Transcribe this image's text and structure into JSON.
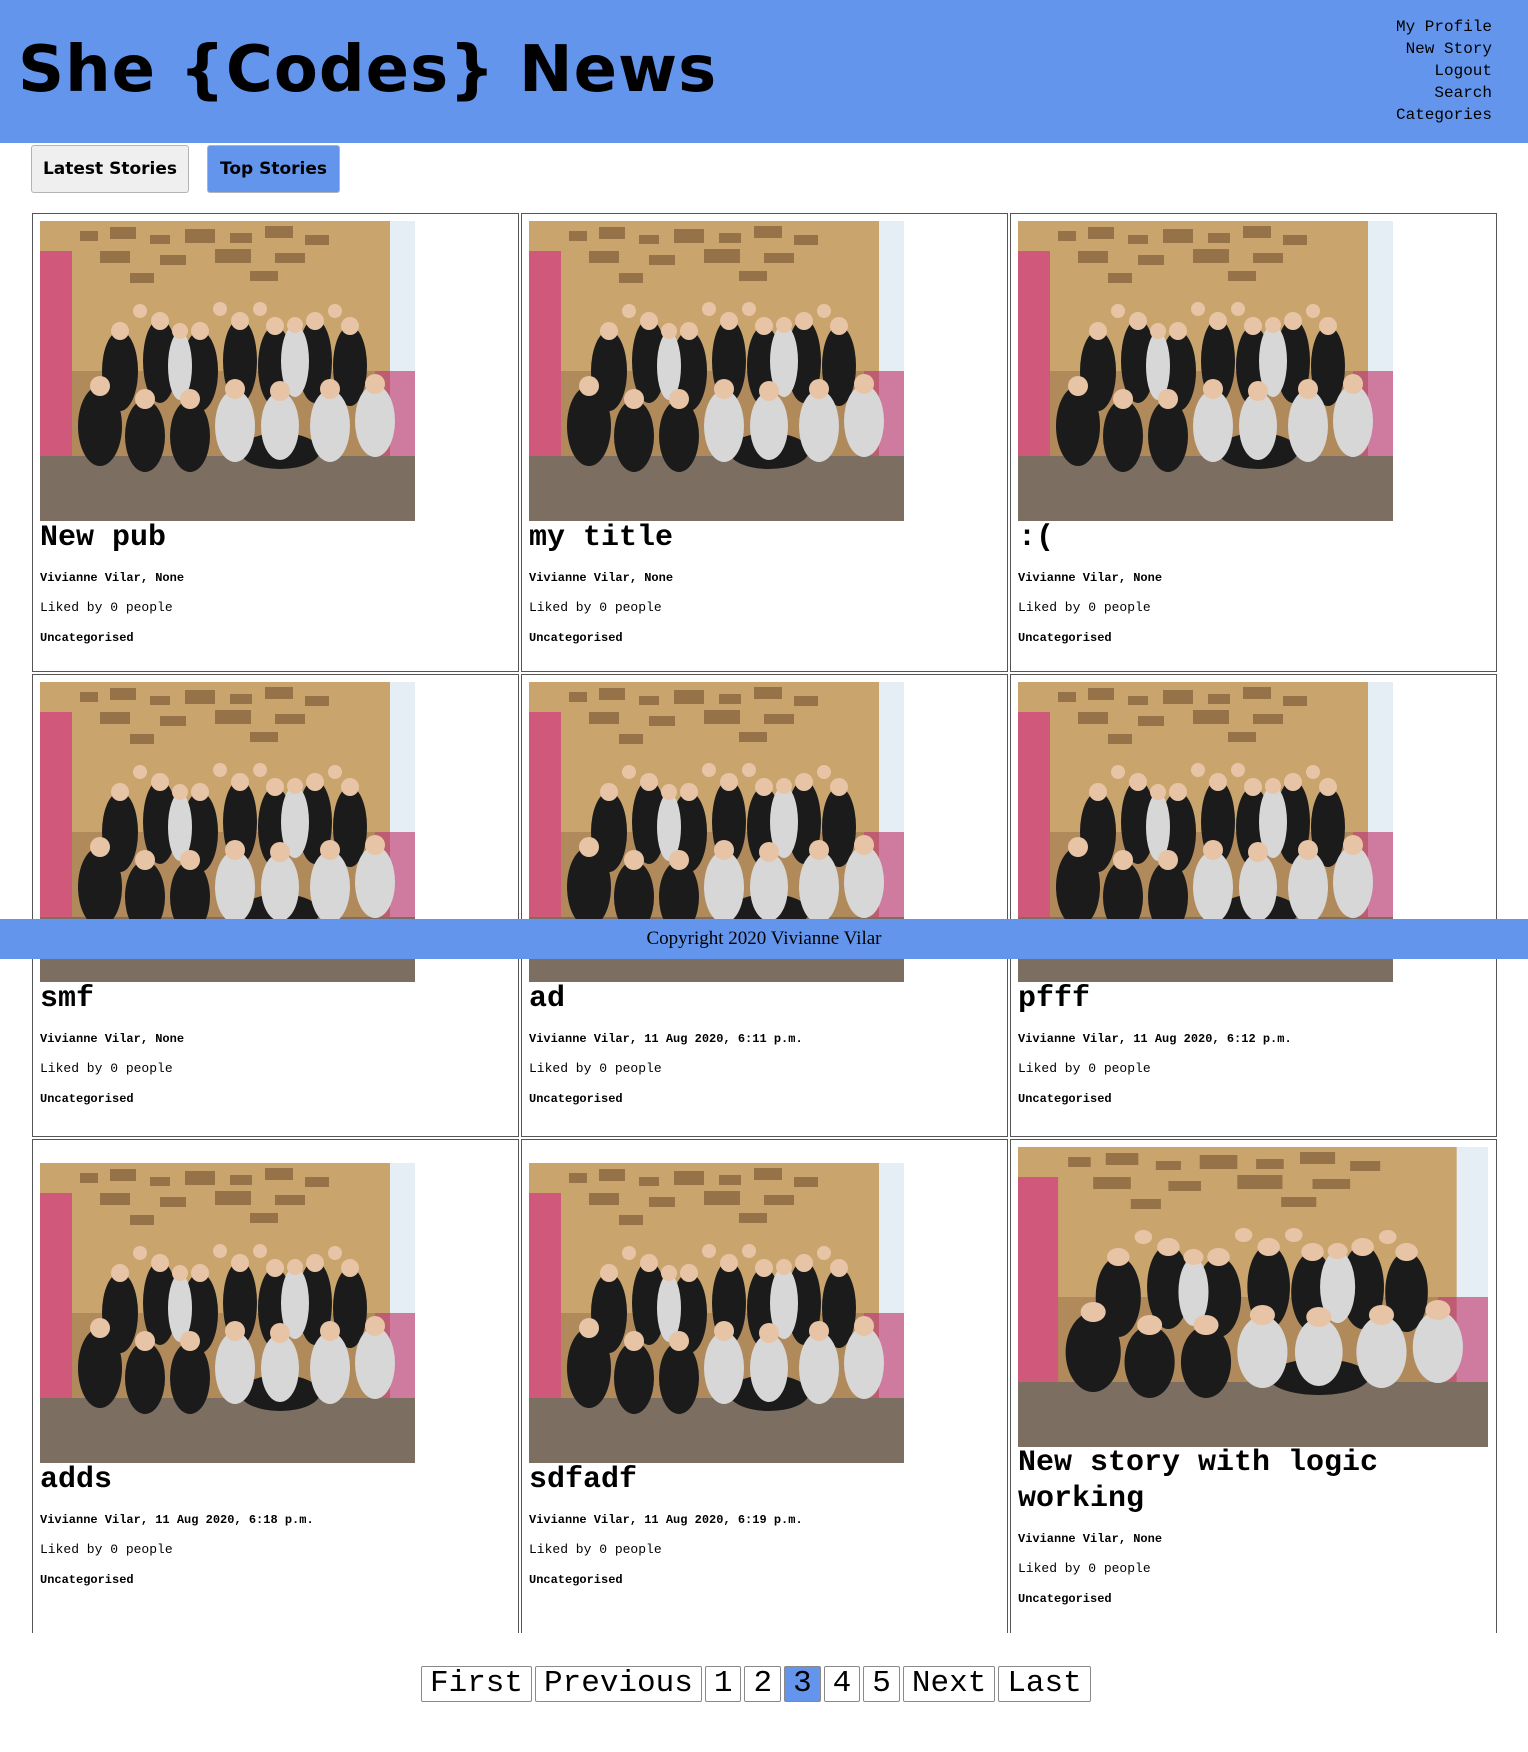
{
  "site": {
    "title": "She {Codes} News"
  },
  "nav": {
    "items": [
      "My Profile",
      "New Story",
      "Logout",
      "Search",
      "Categories"
    ]
  },
  "tabs": {
    "latest": "Latest Stories",
    "top": "Top Stories"
  },
  "stories": [
    {
      "title": "New pub",
      "author": "Vivianne Vilar, None",
      "likes": "Liked by 0 people",
      "category": "Uncategorised"
    },
    {
      "title": "my title",
      "author": "Vivianne Vilar, None",
      "likes": "Liked by 0 people",
      "category": "Uncategorised"
    },
    {
      "title": ":(",
      "author": "Vivianne Vilar, None",
      "likes": "Liked by 0 people",
      "category": "Uncategorised"
    },
    {
      "title": "smf",
      "author": "Vivianne Vilar, None",
      "likes": "Liked by 0 people",
      "category": "Uncategorised"
    },
    {
      "title": "ad",
      "author": "Vivianne Vilar, 11 Aug 2020, 6:11 p.m.",
      "likes": "Liked by 0 people",
      "category": "Uncategorised"
    },
    {
      "title": "pfff",
      "author": "Vivianne Vilar, 11 Aug 2020, 6:12 p.m.",
      "likes": "Liked by 0 people",
      "category": "Uncategorised"
    },
    {
      "title": "adds",
      "author": "Vivianne Vilar, 11 Aug 2020, 6:18 p.m.",
      "likes": "Liked by 0 people",
      "category": "Uncategorised"
    },
    {
      "title": "sdfadf",
      "author": "Vivianne Vilar, 11 Aug 2020, 6:19 p.m.",
      "likes": "Liked by 0 people",
      "category": "Uncategorised"
    },
    {
      "title": "New story with logic working",
      "author": "Vivianne Vilar, None",
      "likes": "Liked by 0 people",
      "category": "Uncategorised"
    }
  ],
  "footer": {
    "text": "Copyright 2020 Vivianne Vilar"
  },
  "pagination": {
    "first": "First",
    "previous": "Previous",
    "pages": [
      "1",
      "2",
      "3",
      "4",
      "5"
    ],
    "current": "3",
    "next": "Next",
    "last": "Last"
  },
  "colors": {
    "accent": "#6495ed",
    "button": "#efefef"
  }
}
